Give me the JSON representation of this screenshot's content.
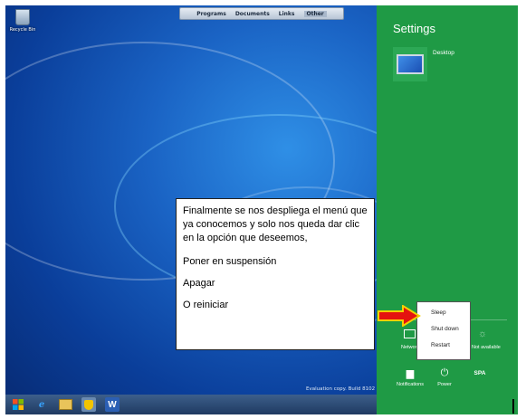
{
  "toolbar": {
    "items": [
      "Programs",
      "Documents",
      "Links",
      "Other"
    ]
  },
  "desktop": {
    "recycle_bin_label": "Recycle Bin",
    "evaluation_text": "Evaluation copy. Build 8102"
  },
  "taskbar": {
    "word_letter": "W"
  },
  "settings": {
    "title": "Settings",
    "desktop_tile_label": "Desktop",
    "network_label": "Network",
    "unavailable_label": "Not available",
    "power_menu": [
      "Sleep",
      "Shut down",
      "Restart"
    ],
    "bottom": {
      "notifications": "Notifications",
      "power": "Power",
      "language": "SPA"
    }
  },
  "callout": {
    "intro": "Finalmente se nos despliega el menú que ya conocemos y solo nos queda dar clic en la opción que deseemos,",
    "option1": "Poner en suspensión",
    "option2": "Apagar",
    "option3": "O reiniciar"
  },
  "colors": {
    "charms_bg": "#1f9a45",
    "arrow": "#e5120f",
    "arrow_outline": "#f4d000"
  }
}
